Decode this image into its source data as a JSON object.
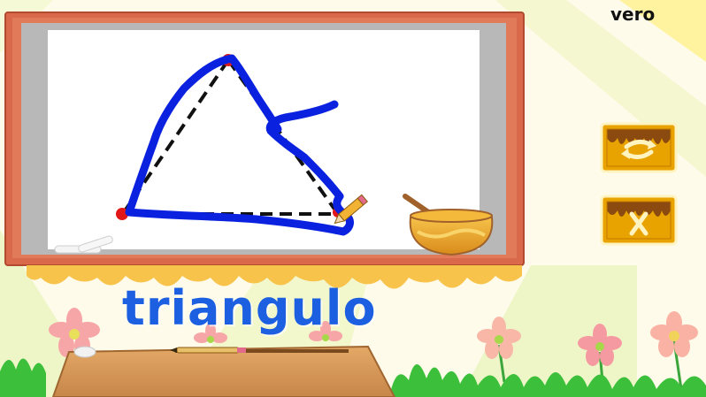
{
  "player": {
    "name": "vero"
  },
  "lesson": {
    "word": "triangulo"
  },
  "controls": {
    "redo_icon": "recycle-arrows-icon",
    "close_icon": "x-icon"
  },
  "colors": {
    "drawing_stroke": "#0a22e0",
    "word_text": "#1c5fe0",
    "button_fill": "#e8a300",
    "board_frame": "#d9694a"
  }
}
